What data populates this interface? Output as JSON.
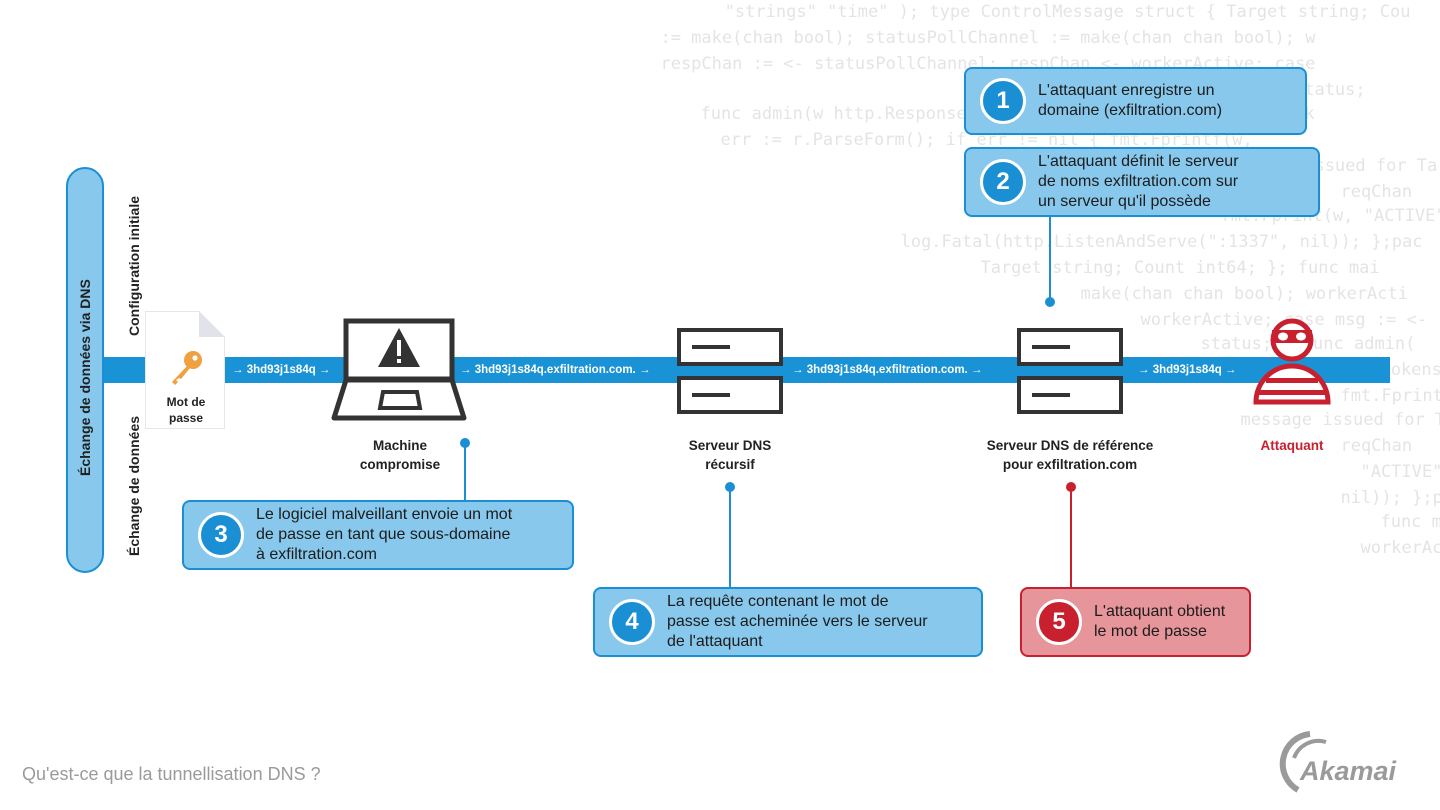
{
  "background_code": [
    "                    \"strings\" \"time\" ); type ControlMessage struct { Target string; Cou",
    "  := make(chan bool); statusPollChannel := make(chan chan bool); w",
    "  respChan := <- statusPollChannel; respChan <- workerActive; case",
    "  workerActive = status;",
    "  func admin(w http.ResponseWriter, r *http.Request) { hostTok",
    "  err := r.ParseForm(); if err != nil { fmt.Fprintf(w,",
    "  Control message issued for Tar",
    "  reqChan",
    "  fmt.Fprint(w, \"ACTIVE\"",
    "  log.Fatal(http.ListenAndServe(\":1337\", nil)); };pac",
    "  Target string; Count int64; }; func mai",
    "  make(chan chan bool); workerActi",
    "  workerActive; case msg := <-",
    "  status; } func admin(",
    "  tokens",
    "  fmt.Fprintf(w,",
    "  message issued for Ta",
    "  reqChan",
    "  \"ACTIVE\"",
    "  nil)); };pac",
    "  func ma",
    "  workerActi"
  ],
  "section": {
    "title": "Échange de données via DNS",
    "phase_setup": "Configuration initiale",
    "phase_exchange": "Échange de données"
  },
  "document": {
    "label_line1": "Mot de",
    "label_line2": "passe",
    "icon": "key-icon",
    "icon_color": "#f0a040"
  },
  "flow": {
    "segment1": "→ 3hd93j1s84q →",
    "segment2": "→ 3hd93j1s84q.exfiltration.com. →",
    "segment3": "→ 3hd93j1s84q.exfiltration.com. →",
    "segment4": "→ 3hd93j1s84q →"
  },
  "nodes": {
    "compromised": {
      "line1": "Machine",
      "line2": "compromise"
    },
    "recursive": {
      "line1": "Serveur DNS",
      "line2": "récursif"
    },
    "authoritative": {
      "line1": "Serveur DNS de référence",
      "line2": "pour exfiltration.com"
    },
    "attacker": {
      "line1": "Attaquant"
    }
  },
  "steps": [
    {
      "number": "1",
      "lines": [
        "L'attaquant enregistre un",
        "domaine (exfiltration.com)"
      ]
    },
    {
      "number": "2",
      "lines": [
        "L'attaquant définit le serveur",
        "de noms exfiltration.com sur",
        "un serveur qu'il possède"
      ]
    },
    {
      "number": "3",
      "lines": [
        "Le logiciel malveillant envoie un mot",
        "de passe en tant que sous-domaine",
        "à exfiltration.com"
      ]
    },
    {
      "number": "4",
      "lines": [
        "La requête contenant le mot de",
        "passe est acheminée vers le serveur",
        "de l'attaquant"
      ]
    },
    {
      "number": "5",
      "lines": [
        "L'attaquant obtient",
        "le mot de passe"
      ]
    }
  ],
  "colors": {
    "accent_blue": "#1a93d6",
    "callout_blue": "#87c8ec",
    "accent_red": "#c8202e",
    "callout_red": "#e6959a"
  },
  "footer": {
    "title": "Qu'est-ce que la tunnellisation DNS ?",
    "logo": "Akamai"
  }
}
